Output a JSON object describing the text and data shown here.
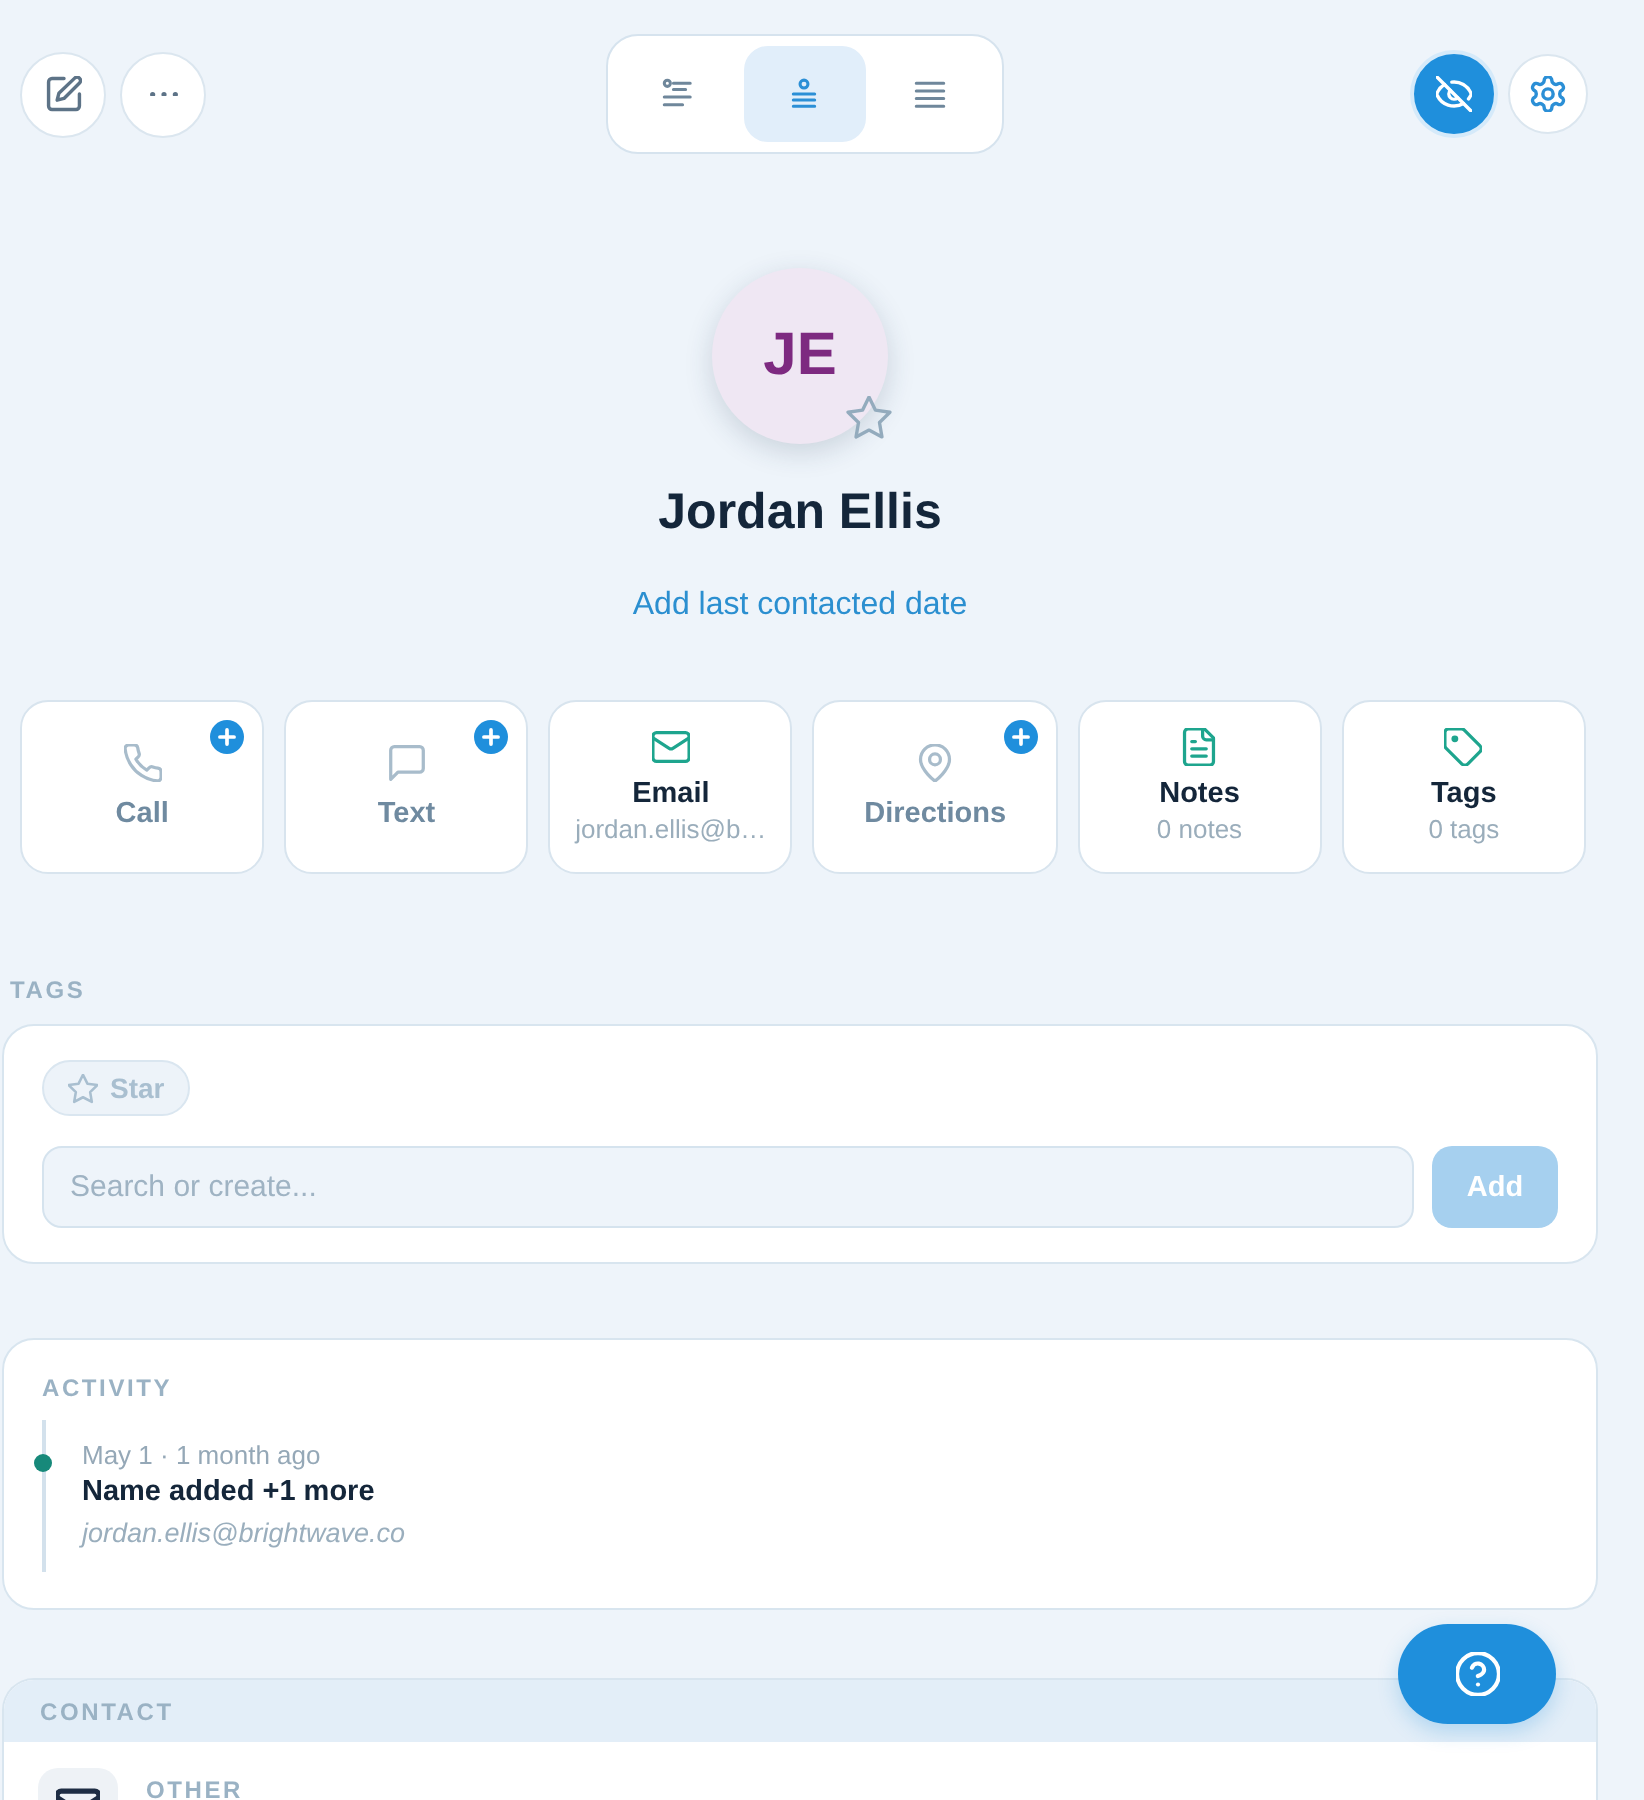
{
  "toolbar": {
    "left_buttons": [
      {
        "kind": "edit"
      },
      {
        "kind": "more"
      }
    ],
    "views": [
      {
        "kind": "summary",
        "selected": false
      },
      {
        "kind": "profile",
        "selected": true
      },
      {
        "kind": "list",
        "selected": false
      }
    ],
    "right_buttons": [
      {
        "kind": "hide",
        "on": true
      },
      {
        "kind": "settings",
        "on": false
      }
    ]
  },
  "profile": {
    "initials": "JE",
    "favorite": false,
    "name": "Jordan Ellis",
    "last_contacted_link": "Add last contacted date"
  },
  "actions": [
    {
      "kind": "call",
      "label": "Call",
      "enabled": false
    },
    {
      "kind": "text",
      "label": "Text",
      "enabled": false
    },
    {
      "kind": "email",
      "label": "Email",
      "detail": "jordan.ellis@b…",
      "enabled": true
    },
    {
      "kind": "directions",
      "label": "Directions",
      "enabled": false
    },
    {
      "kind": "notes",
      "label": "Notes",
      "detail": "0 notes",
      "enabled": true
    },
    {
      "kind": "tags",
      "label": "Tags",
      "detail": "0 tags",
      "enabled": true
    }
  ],
  "tags": {
    "title": "TAGS",
    "chips": [
      {
        "kind": "star",
        "label": "Star",
        "selected": false
      }
    ],
    "search": {
      "placeholder": "Search or create..."
    },
    "add_button": {
      "label": "Add",
      "disabled": true
    }
  },
  "activity": {
    "title": "ACTIVITY",
    "entries": [
      {
        "meta": "May 1 · 1 month ago",
        "title": "Name added +1 more",
        "detail": "jordan.ellis@brightwave.co"
      }
    ]
  },
  "contact": {
    "title": "CONTACT",
    "items": [
      {
        "kind": "email",
        "label": "OTHER"
      }
    ]
  }
}
